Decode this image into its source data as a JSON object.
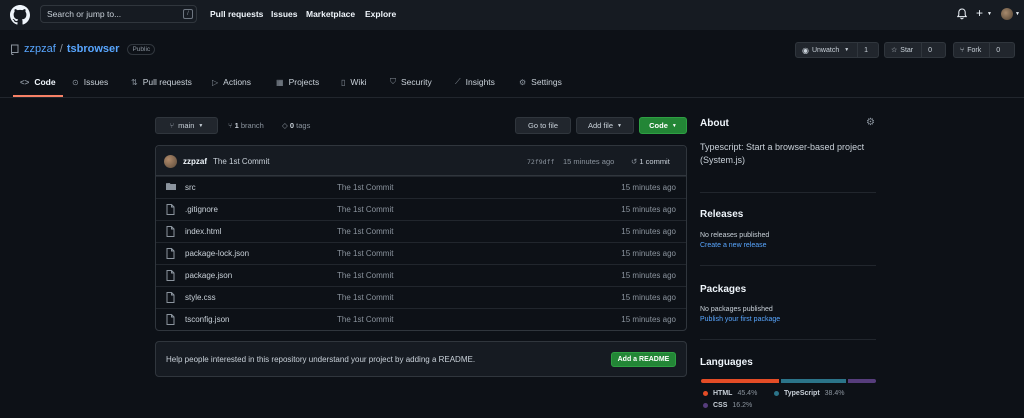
{
  "colors": {
    "html": "#e34c26",
    "typescript": "#2b7489",
    "css": "#563d7c",
    "accent_green": "#238636",
    "link": "#58a6ff"
  },
  "topbar": {
    "search_placeholder": "Search or jump to...",
    "search_shortcut": "/",
    "nav": [
      "Pull requests",
      "Issues",
      "Marketplace",
      "Explore"
    ],
    "icons": [
      "bell-icon",
      "plus-icon",
      "avatar"
    ]
  },
  "repo": {
    "owner": "zzpzaf",
    "separator": "/",
    "name": "tsbrowser",
    "visibility": "Public"
  },
  "actions": {
    "watch_label": "Unwatch",
    "watch_count": "1",
    "star_label": "Star",
    "star_count": "0",
    "fork_label": "Fork",
    "fork_count": "0"
  },
  "tabs": [
    {
      "label": "Code",
      "icon": "code-icon"
    },
    {
      "label": "Issues",
      "icon": "issue-icon"
    },
    {
      "label": "Pull requests",
      "icon": "pull-request-icon"
    },
    {
      "label": "Actions",
      "icon": "play-icon"
    },
    {
      "label": "Projects",
      "icon": "project-icon"
    },
    {
      "label": "Wiki",
      "icon": "book-icon"
    },
    {
      "label": "Security",
      "icon": "shield-icon"
    },
    {
      "label": "Insights",
      "icon": "graph-icon"
    },
    {
      "label": "Settings",
      "icon": "gear-icon"
    }
  ],
  "branch_bar": {
    "branch": "main",
    "branch_count": "1",
    "branch_word": "branch",
    "tag_count": "0",
    "tag_word": "tags",
    "goto_file": "Go to file",
    "add_file": "Add file",
    "code": "Code"
  },
  "commit": {
    "user": "zzpzaf",
    "message": "The 1st Commit",
    "sha": "72f9dff",
    "time": "15 minutes ago",
    "count": "1 commit"
  },
  "files": [
    {
      "name": "src",
      "type": "dir",
      "message": "The 1st Commit",
      "time": "15 minutes ago"
    },
    {
      "name": ".gitignore",
      "type": "file",
      "message": "The 1st Commit",
      "time": "15 minutes ago"
    },
    {
      "name": "index.html",
      "type": "file",
      "message": "The 1st Commit",
      "time": "15 minutes ago"
    },
    {
      "name": "package-lock.json",
      "type": "file",
      "message": "The 1st Commit",
      "time": "15 minutes ago"
    },
    {
      "name": "package.json",
      "type": "file",
      "message": "The 1st Commit",
      "time": "15 minutes ago"
    },
    {
      "name": "style.css",
      "type": "file",
      "message": "The 1st Commit",
      "time": "15 minutes ago"
    },
    {
      "name": "tsconfig.json",
      "type": "file",
      "message": "The 1st Commit",
      "time": "15 minutes ago"
    }
  ],
  "readme": {
    "text": "Help people interested in this repository understand your project by adding a README.",
    "button": "Add a README"
  },
  "sidebar": {
    "about_title": "About",
    "about_desc": "Typescript: Start a browser-based project (System.js)",
    "releases_title": "Releases",
    "releases_text": "No releases published",
    "releases_link": "Create a new release",
    "packages_title": "Packages",
    "packages_text": "No packages published",
    "packages_link": "Publish your first package",
    "languages_title": "Languages",
    "languages": [
      {
        "name": "HTML",
        "percent": "45.4%",
        "value": 45.4
      },
      {
        "name": "TypeScript",
        "percent": "38.4%",
        "value": 38.4
      },
      {
        "name": "CSS",
        "percent": "16.2%",
        "value": 16.2
      }
    ]
  }
}
